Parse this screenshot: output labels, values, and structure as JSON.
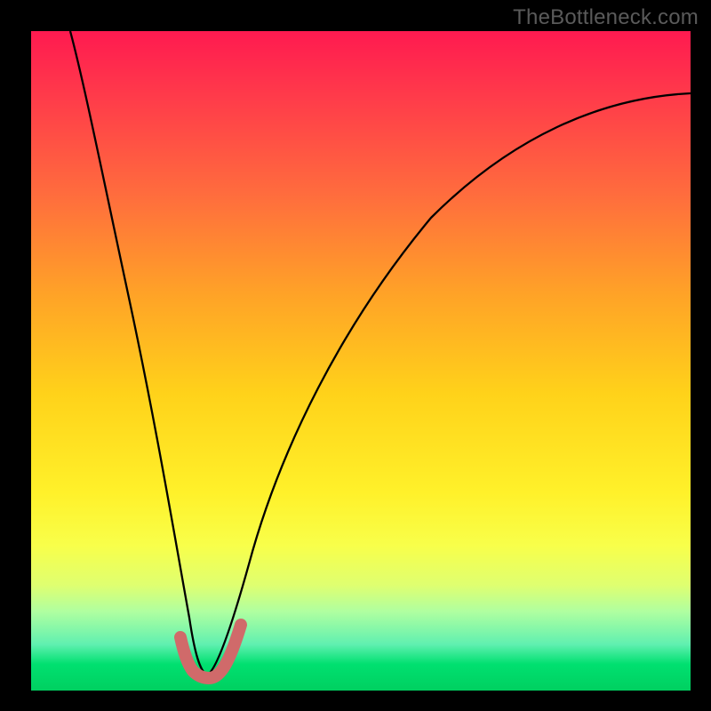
{
  "watermark": "TheBottleneck.com",
  "chart_data": {
    "type": "line",
    "title": "",
    "xlabel": "",
    "ylabel": "",
    "xlim": [
      0,
      100
    ],
    "ylim": [
      0,
      100
    ],
    "grid": false,
    "legend": false,
    "series": [
      {
        "name": "bottleneck-curve",
        "x": [
          6,
          8,
          10,
          12,
          14,
          16,
          18,
          20,
          22,
          23.5,
          25,
          27,
          29,
          31,
          34,
          38,
          43,
          50,
          58,
          66,
          75,
          85,
          95,
          100
        ],
        "values": [
          100,
          88,
          77,
          66,
          55,
          44,
          33,
          22,
          12,
          3,
          2,
          3,
          10,
          18,
          28,
          38,
          48,
          58,
          66,
          72,
          77,
          81,
          83,
          84
        ]
      },
      {
        "name": "valley-marker",
        "x": [
          22.0,
          22.6,
          23.2,
          23.8,
          24.4,
          25.0,
          25.6,
          26.2,
          26.8,
          27.4,
          28.0
        ],
        "values": [
          7.0,
          4.6,
          3.2,
          2.4,
          2.0,
          2.0,
          2.2,
          3.0,
          4.2,
          6.0,
          8.5
        ]
      }
    ],
    "colors": {
      "gradient_top": "#ff1a50",
      "gradient_mid": "#ffd21a",
      "gradient_bottom": "#00d060",
      "curve": "#000000",
      "marker": "#d06a6a"
    }
  }
}
